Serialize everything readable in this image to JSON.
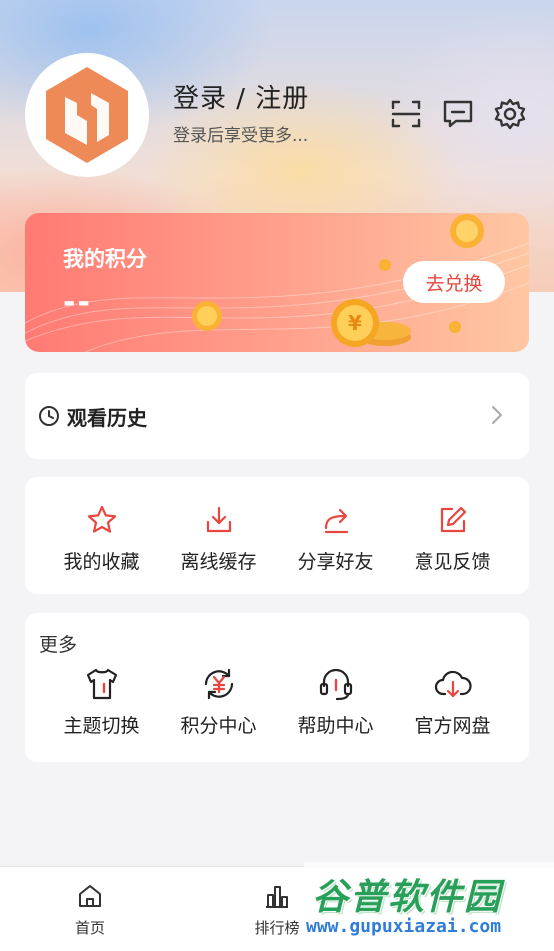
{
  "header": {
    "login_title": "登录 / 注册",
    "login_subtitle": "登录后享受更多..."
  },
  "top_icons": [
    "scan-icon",
    "message-icon",
    "gear-icon"
  ],
  "points_card": {
    "title": "我的积分",
    "value": "--",
    "redeem_label": "去兑换"
  },
  "history": {
    "label": "观看历史"
  },
  "quick_actions": [
    {
      "icon": "star-icon",
      "label": "我的收藏"
    },
    {
      "icon": "download-icon",
      "label": "离线缓存"
    },
    {
      "icon": "share-icon",
      "label": "分享好友"
    },
    {
      "icon": "edit-icon",
      "label": "意见反馈"
    }
  ],
  "more": {
    "title": "更多",
    "items": [
      {
        "icon": "tshirt-icon",
        "label": "主题切换"
      },
      {
        "icon": "points-exchange-icon",
        "label": "积分中心"
      },
      {
        "icon": "headset-icon",
        "label": "帮助中心"
      },
      {
        "icon": "cloud-download-icon",
        "label": "官方网盘"
      }
    ]
  },
  "tabbar": {
    "items": [
      {
        "icon": "home-icon",
        "label": "首页"
      },
      {
        "icon": "bar-chart-icon",
        "label": "排行榜"
      }
    ]
  },
  "watermark": {
    "logo_text": "谷普软件园",
    "url": "www.gupuxiazai.com"
  },
  "colors": {
    "accent": "#e8463e",
    "logo_orange": "#ee8a58",
    "points_gradient_start": "#ff7a73",
    "points_gradient_end": "#ffc7a3"
  }
}
